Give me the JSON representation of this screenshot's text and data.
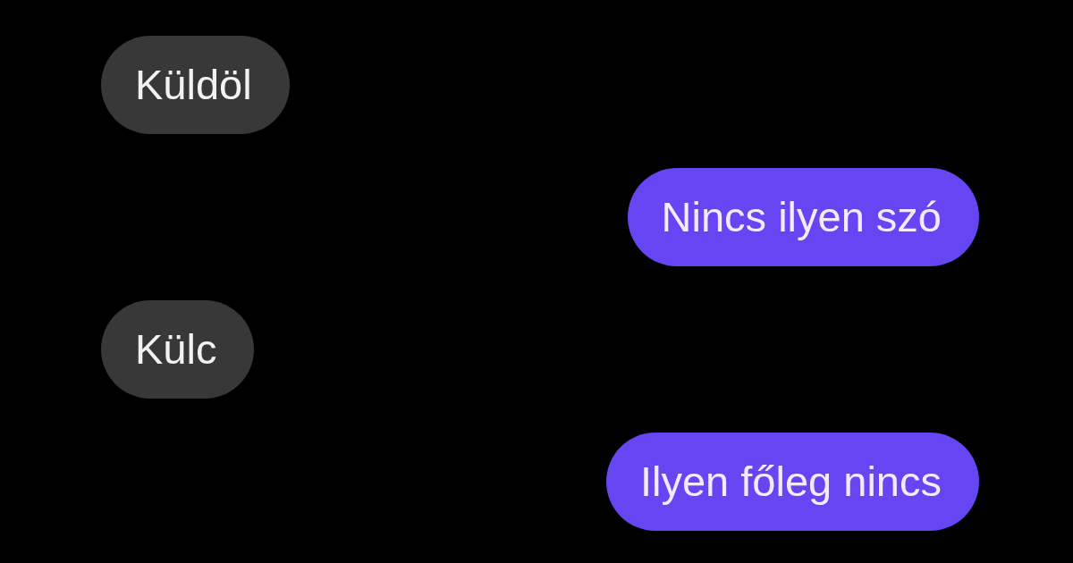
{
  "messages": [
    {
      "kind": "received",
      "text": "Küldöl"
    },
    {
      "kind": "sent",
      "text": "Nincs ilyen szó"
    },
    {
      "kind": "received",
      "text": "Külc"
    },
    {
      "kind": "sent",
      "text": "Ilyen főleg nincs"
    }
  ]
}
